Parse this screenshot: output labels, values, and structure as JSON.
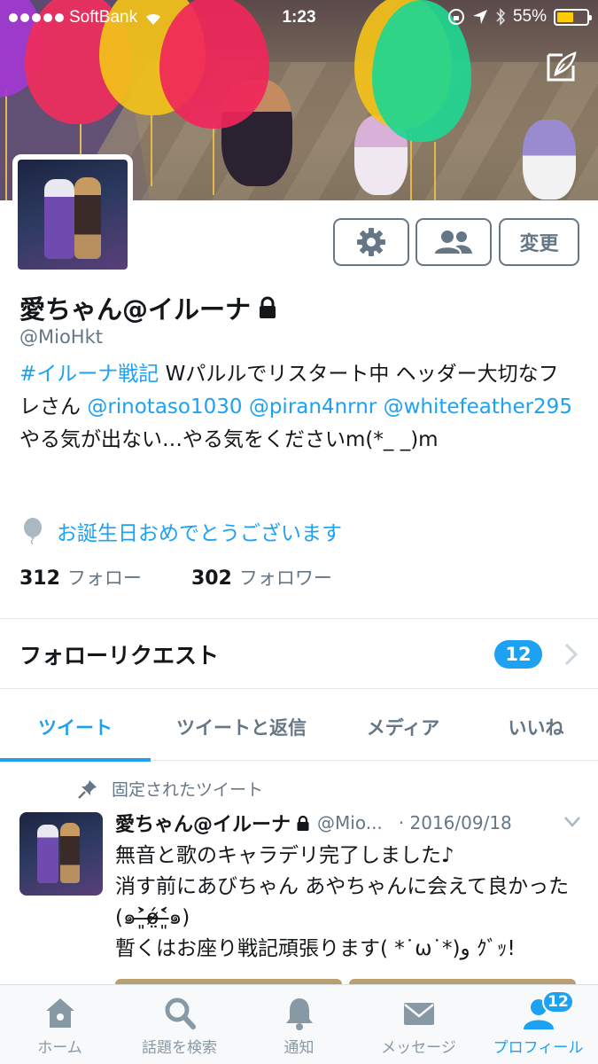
{
  "status_bar": {
    "carrier": "SoftBank",
    "time": "1:23",
    "battery": "55%",
    "battery_level": 0.55
  },
  "profile": {
    "display_name": "愛ちゃん@イルーナ",
    "handle": "@MioHkt",
    "bio_hashtag": "#イルーナ戦記",
    "bio_text1": " Wパルルでリスタート中 ヘッダー大切なフレさん ",
    "bio_mention1": "@rinotaso1030",
    "bio_mention2": "@piran4nrnr",
    "bio_mention3": "@whitefeather295",
    "bio_text2": " やる気が出ない…やる気をくださいm(*_ _)m",
    "birthday": "お誕生日おめでとうございます",
    "following_count": "312",
    "following_label": "フォロー",
    "followers_count": "302",
    "followers_label": "フォロワー"
  },
  "buttons": {
    "change_label": "変更"
  },
  "follow_requests": {
    "label": "フォローリクエスト",
    "count": "12"
  },
  "tabs": [
    {
      "label": "ツイート"
    },
    {
      "label": "ツイートと返信"
    },
    {
      "label": "メディア"
    },
    {
      "label": "いいね"
    }
  ],
  "pinned_tweet": {
    "pinned_label": "固定されたツイート",
    "author_name": "愛ちゃん@イルーナ",
    "author_handle": "@Mio...",
    "date": "· 2016/09/18",
    "line1": "無音と歌のキャラデリ完了しました♪",
    "line2": "消す前にあびちゃん あやちゃんに会えて良かった(๑˃̶͈̀ó̴̶̷̤˂̶͈́๑)",
    "line3": "暫くはお座り戦記頑張ります( *˙ω˙*)و ｸﾞｯ!"
  },
  "tab_bar": {
    "items": [
      {
        "label": "ホーム",
        "icon": "home-icon"
      },
      {
        "label": "話題を検索",
        "icon": "search-icon"
      },
      {
        "label": "通知",
        "icon": "bell-icon"
      },
      {
        "label": "メッセージ",
        "icon": "envelope-icon"
      },
      {
        "label": "プロフィール",
        "icon": "profile-icon"
      }
    ],
    "profile_badge": "12"
  },
  "colors": {
    "accent": "#1da1f2",
    "text": "#14171a",
    "secondary": "#657786"
  }
}
